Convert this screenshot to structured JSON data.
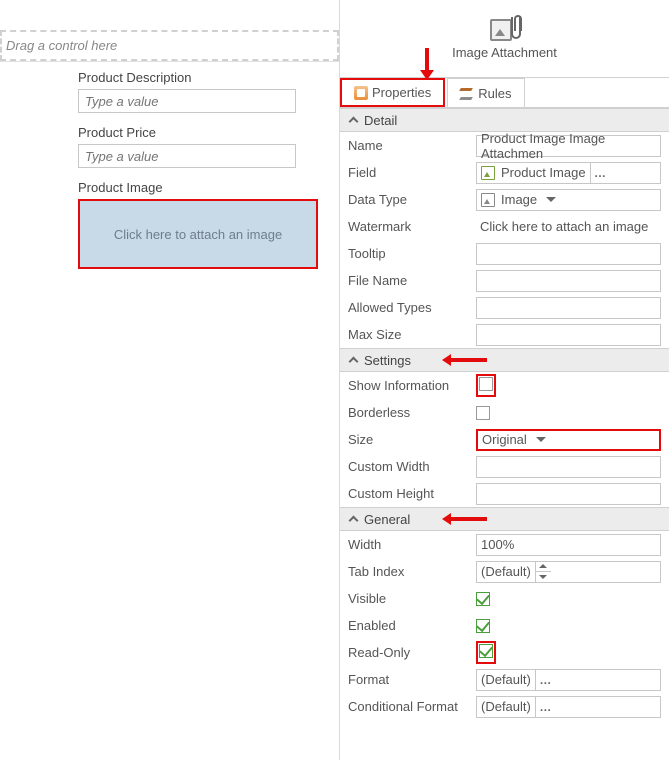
{
  "canvas": {
    "drag_hint": "Drag a control here",
    "fields": {
      "desc_label": "Product Description",
      "desc_placeholder": "Type a value",
      "price_label": "Product Price",
      "price_placeholder": "Type a value",
      "image_label": "Product Image",
      "image_hint": "Click here to attach an image"
    }
  },
  "header": {
    "title": "Image Attachment",
    "tabs": {
      "properties": "Properties",
      "rules": "Rules"
    }
  },
  "groups": {
    "detail": {
      "title": "Detail",
      "rows": {
        "name": {
          "label": "Name",
          "value": "Product Image Image Attachmen"
        },
        "field": {
          "label": "Field",
          "value": "Product Image"
        },
        "datatype": {
          "label": "Data Type",
          "value": "Image"
        },
        "watermark": {
          "label": "Watermark",
          "value": "Click here to attach an image"
        },
        "tooltip": {
          "label": "Tooltip",
          "value": ""
        },
        "filename": {
          "label": "File Name",
          "value": ""
        },
        "allowed": {
          "label": "Allowed Types",
          "value": ""
        },
        "maxsize": {
          "label": "Max Size",
          "value": ""
        }
      }
    },
    "settings": {
      "title": "Settings",
      "rows": {
        "showinfo": {
          "label": "Show Information"
        },
        "borderless": {
          "label": "Borderless"
        },
        "size": {
          "label": "Size",
          "value": "Original"
        },
        "cwidth": {
          "label": "Custom Width",
          "value": ""
        },
        "cheight": {
          "label": "Custom Height",
          "value": ""
        }
      }
    },
    "general": {
      "title": "General",
      "rows": {
        "width": {
          "label": "Width",
          "value": "100%"
        },
        "tabindex": {
          "label": "Tab Index",
          "value": "(Default)"
        },
        "visible": {
          "label": "Visible"
        },
        "enabled": {
          "label": "Enabled"
        },
        "readonly": {
          "label": "Read-Only"
        },
        "format": {
          "label": "Format",
          "value": "(Default)"
        },
        "cformat": {
          "label": "Conditional Format",
          "value": "(Default)"
        }
      }
    }
  }
}
